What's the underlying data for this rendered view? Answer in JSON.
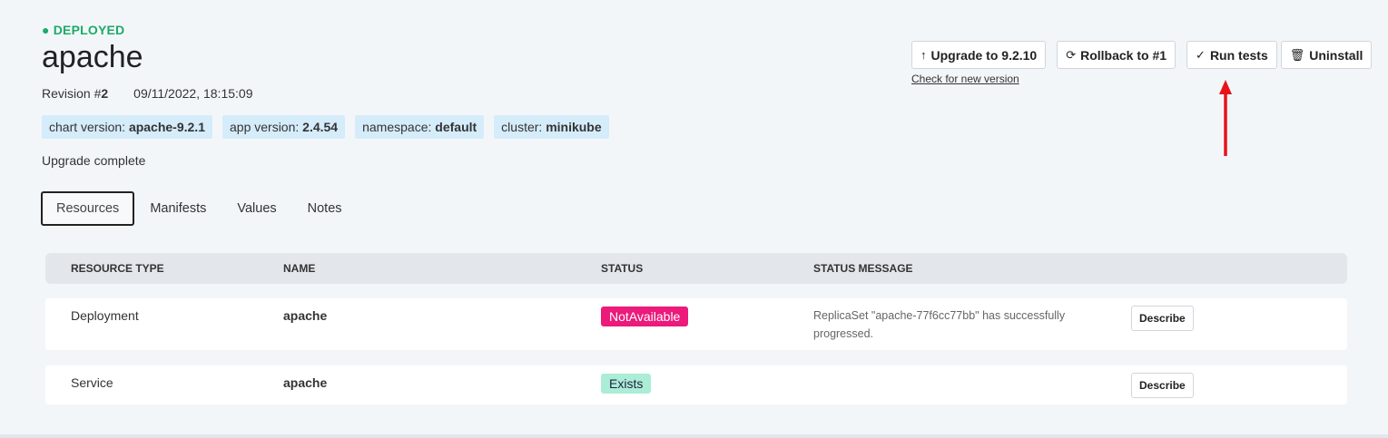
{
  "release": {
    "status": "● DEPLOYED",
    "name": "apache",
    "revision_label": "Revision #",
    "revision_number": "2",
    "updated": "09/11/2022, 18:15:09",
    "message": "Upgrade complete"
  },
  "badges": [
    {
      "key": "chart version:",
      "value": "apache-9.2.1"
    },
    {
      "key": "app version:",
      "value": "2.4.54"
    },
    {
      "key": "namespace:",
      "value": "default"
    },
    {
      "key": "cluster:",
      "value": "minikube"
    }
  ],
  "actions": {
    "upgrade": {
      "icon": "↑",
      "label": "Upgrade to 9.2.10"
    },
    "rollback": {
      "icon": "⟳",
      "label": "Rollback to #1"
    },
    "run_tests": {
      "icon": "✓",
      "label": "Run tests"
    },
    "uninstall": {
      "icon": "🗑",
      "label": "Uninstall"
    },
    "check_link": "Check for new version"
  },
  "tabs": [
    "Resources",
    "Manifests",
    "Values",
    "Notes"
  ],
  "table": {
    "headers": [
      "RESOURCE TYPE",
      "NAME",
      "STATUS",
      "STATUS MESSAGE"
    ],
    "rows": [
      {
        "type": "Deployment",
        "name": "apache",
        "status": "NotAvailable",
        "message": "ReplicaSet \"apache-77f6cc77bb\" has successfully progressed.",
        "action": "Describe"
      },
      {
        "type": "Service",
        "name": "apache",
        "status": "Exists",
        "message": "",
        "action": "Describe"
      }
    ]
  },
  "colors": {
    "deployed": "#1bab68",
    "not_available": "#eb1a7b",
    "exists": "#abedd5",
    "arrow": "#e8131b"
  }
}
